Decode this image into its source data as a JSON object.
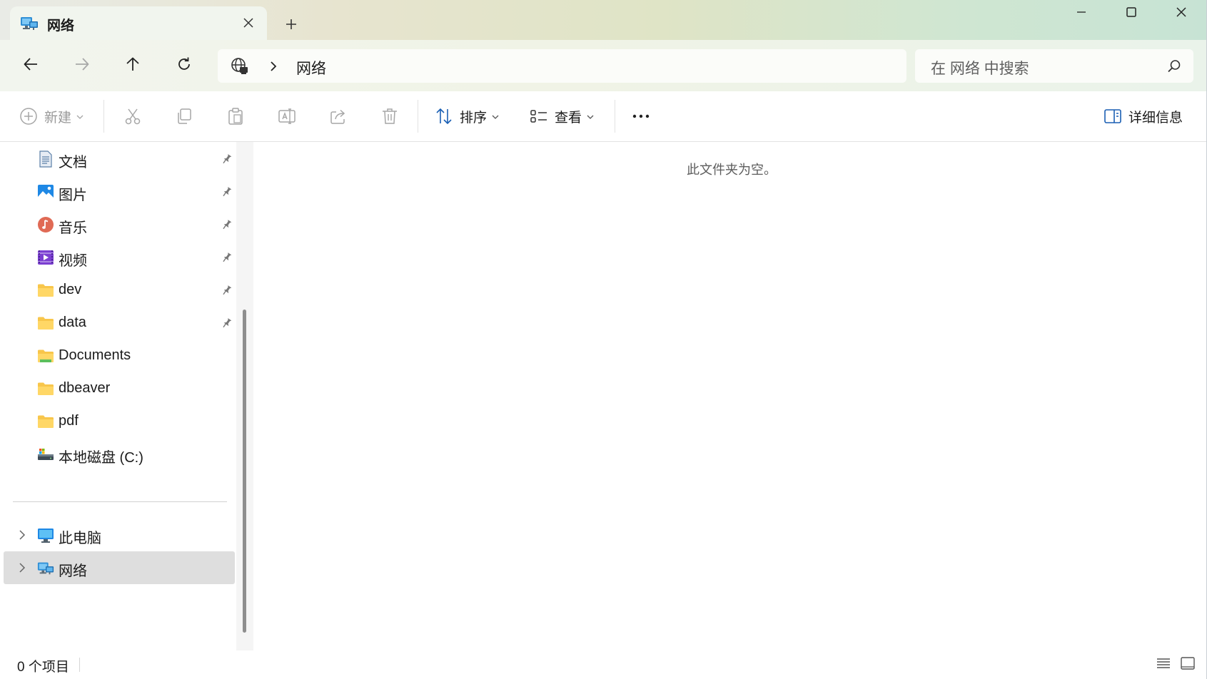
{
  "tab": {
    "title": "网络",
    "icon": "network-icon"
  },
  "window_controls": {
    "minimize": "minimize-icon",
    "maximize": "maximize-icon",
    "close": "close-icon"
  },
  "address": {
    "icon": "globe-icon",
    "path": [
      "网络"
    ]
  },
  "search": {
    "placeholder": "在 网络 中搜索"
  },
  "commands": {
    "new_label": "新建",
    "sort_label": "排序",
    "view_label": "查看",
    "details_label": "详细信息"
  },
  "sidebar": {
    "quick_access": [
      {
        "label": "文档",
        "icon": "documents-icon",
        "pinned": true
      },
      {
        "label": "图片",
        "icon": "pictures-icon",
        "pinned": true
      },
      {
        "label": "音乐",
        "icon": "music-icon",
        "pinned": true
      },
      {
        "label": "视频",
        "icon": "videos-icon",
        "pinned": true
      },
      {
        "label": "dev",
        "icon": "folder-icon",
        "pinned": true
      },
      {
        "label": "data",
        "icon": "folder-icon",
        "pinned": true
      },
      {
        "label": "Documents",
        "icon": "folder-icon",
        "pinned": false
      },
      {
        "label": "dbeaver",
        "icon": "folder-icon",
        "pinned": false
      },
      {
        "label": "pdf",
        "icon": "folder-icon",
        "pinned": false
      },
      {
        "label": "本地磁盘 (C:)",
        "icon": "drive-icon",
        "pinned": false
      }
    ],
    "locations": [
      {
        "label": "此电脑",
        "icon": "computer-icon",
        "selected": false
      },
      {
        "label": "网络",
        "icon": "network-icon",
        "selected": true
      }
    ]
  },
  "content": {
    "empty_message": "此文件夹为空。"
  },
  "status": {
    "item_count": "0 个项目"
  },
  "colors": {
    "accent": "#0067c0",
    "selected_bg": "#dedede",
    "folder": "#f8c64b"
  }
}
